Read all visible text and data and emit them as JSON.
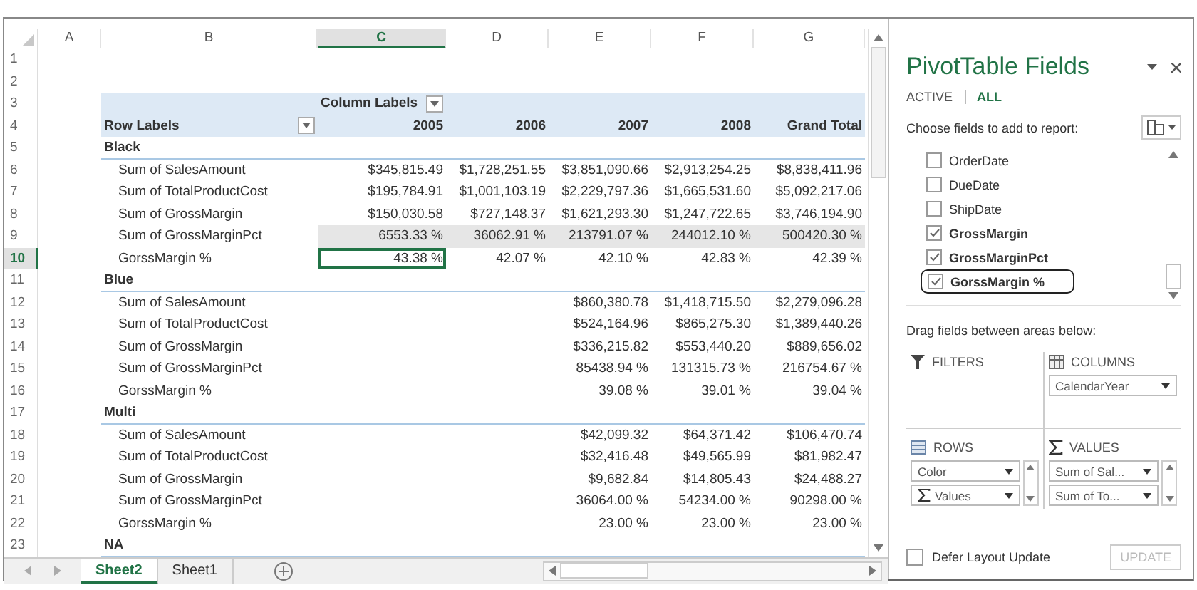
{
  "sheet": {
    "columns": [
      {
        "label": "A",
        "selected": false
      },
      {
        "label": "B",
        "selected": false
      },
      {
        "label": "C",
        "selected": true
      },
      {
        "label": "D",
        "selected": false
      },
      {
        "label": "E",
        "selected": false
      },
      {
        "label": "F",
        "selected": false
      },
      {
        "label": "G",
        "selected": false
      }
    ],
    "rows": [
      {
        "number": "1",
        "kind": "blank",
        "selected": false
      },
      {
        "number": "2",
        "kind": "blank",
        "selected": false
      },
      {
        "number": "3",
        "kind": "column-labels",
        "y2005": "Column Labels",
        "selected": false
      },
      {
        "number": "4",
        "kind": "header",
        "label": "Row Labels",
        "y2005": "2005",
        "y2006": "2006",
        "y2007": "2007",
        "y2008": "2008",
        "grand_total": "Grand Total",
        "selected": false
      },
      {
        "number": "5",
        "kind": "group",
        "label": "Black",
        "selected": false
      },
      {
        "number": "6",
        "kind": "measure",
        "label": "Sum of SalesAmount",
        "y2005": "$345,815.49",
        "y2006": "$1,728,251.55",
        "y2007": "$3,851,090.66",
        "y2008": "$2,913,254.25",
        "grand_total": "$8,838,411.96",
        "shaded": false,
        "selected": false
      },
      {
        "number": "7",
        "kind": "measure",
        "label": "Sum of TotalProductCost",
        "y2005": "$195,784.91",
        "y2006": "$1,001,103.19",
        "y2007": "$2,229,797.36",
        "y2008": "$1,665,531.60",
        "grand_total": "$5,092,217.06",
        "shaded": false,
        "selected": false
      },
      {
        "number": "8",
        "kind": "measure",
        "label": "Sum of GrossMargin",
        "y2005": "$150,030.58",
        "y2006": "$727,148.37",
        "y2007": "$1,621,293.30",
        "y2008": "$1,247,722.65",
        "grand_total": "$3,746,194.90",
        "shaded": false,
        "selected": false
      },
      {
        "number": "9",
        "kind": "measure",
        "label": "Sum of GrossMarginPct",
        "y2005": "6553.33 %",
        "y2006": "36062.91 %",
        "y2007": "213791.07 %",
        "y2008": "244012.10 %",
        "grand_total": "500420.30 %",
        "shaded": true,
        "selected": false
      },
      {
        "number": "10",
        "kind": "measure",
        "label": "GorssMargin %",
        "y2005": "43.38 %",
        "y2006": "42.07 %",
        "y2007": "42.10 %",
        "y2008": "42.83 %",
        "grand_total": "42.39 %",
        "shaded": false,
        "selected": true
      },
      {
        "number": "11",
        "kind": "group",
        "label": "Blue",
        "selected": false
      },
      {
        "number": "12",
        "kind": "measure",
        "label": "Sum of SalesAmount",
        "y2007": "$860,380.78",
        "y2008": "$1,418,715.50",
        "grand_total": "$2,279,096.28",
        "shaded": false,
        "selected": false
      },
      {
        "number": "13",
        "kind": "measure",
        "label": "Sum of TotalProductCost",
        "y2007": "$524,164.96",
        "y2008": "$865,275.30",
        "grand_total": "$1,389,440.26",
        "shaded": false,
        "selected": false
      },
      {
        "number": "14",
        "kind": "measure",
        "label": "Sum of GrossMargin",
        "y2007": "$336,215.82",
        "y2008": "$553,440.20",
        "grand_total": "$889,656.02",
        "shaded": false,
        "selected": false
      },
      {
        "number": "15",
        "kind": "measure",
        "label": "Sum of GrossMarginPct",
        "y2007": "85438.94 %",
        "y2008": "131315.73 %",
        "grand_total": "216754.67 %",
        "shaded": false,
        "selected": false
      },
      {
        "number": "16",
        "kind": "measure",
        "label": "GorssMargin %",
        "y2007": "39.08 %",
        "y2008": "39.01 %",
        "grand_total": "39.04 %",
        "shaded": false,
        "selected": false
      },
      {
        "number": "17",
        "kind": "group",
        "label": "Multi",
        "selected": false
      },
      {
        "number": "18",
        "kind": "measure",
        "label": "Sum of SalesAmount",
        "y2007": "$42,099.32",
        "y2008": "$64,371.42",
        "grand_total": "$106,470.74",
        "shaded": false,
        "selected": false
      },
      {
        "number": "19",
        "kind": "measure",
        "label": "Sum of TotalProductCost",
        "y2007": "$32,416.48",
        "y2008": "$49,565.99",
        "grand_total": "$81,982.47",
        "shaded": false,
        "selected": false
      },
      {
        "number": "20",
        "kind": "measure",
        "label": "Sum of GrossMargin",
        "y2007": "$9,682.84",
        "y2008": "$14,805.43",
        "grand_total": "$24,488.27",
        "shaded": false,
        "selected": false
      },
      {
        "number": "21",
        "kind": "measure",
        "label": "Sum of GrossMarginPct",
        "y2007": "36064.00 %",
        "y2008": "54234.00 %",
        "grand_total": "90298.00 %",
        "shaded": false,
        "selected": false
      },
      {
        "number": "22",
        "kind": "measure",
        "label": "GorssMargin %",
        "y2007": "23.00 %",
        "y2008": "23.00 %",
        "grand_total": "23.00 %",
        "shaded": false,
        "selected": false
      },
      {
        "number": "23",
        "kind": "group",
        "label": "NA",
        "selected": false
      }
    ],
    "tabs": [
      {
        "label": "Sheet2",
        "selected": true
      },
      {
        "label": "Sheet1",
        "selected": false
      }
    ]
  },
  "pane": {
    "title": "PivotTable Fields",
    "tabs": [
      {
        "label": "ACTIVE",
        "selected": false
      },
      {
        "label": "ALL",
        "selected": true
      }
    ],
    "instruction": "Choose fields to add to report:",
    "fields": [
      {
        "label": "OrderDate",
        "checked": false,
        "highlighted": false
      },
      {
        "label": "DueDate",
        "checked": false,
        "highlighted": false
      },
      {
        "label": "ShipDate",
        "checked": false,
        "highlighted": false
      },
      {
        "label": "GrossMargin",
        "checked": true,
        "highlighted": false
      },
      {
        "label": "GrossMarginPct",
        "checked": true,
        "highlighted": false
      },
      {
        "label": "GorssMargin %",
        "checked": true,
        "highlighted": true
      }
    ],
    "areas_hint": "Drag fields between areas below:",
    "areas": [
      {
        "kind": "filters",
        "label": "FILTERS"
      },
      {
        "kind": "columns",
        "label": "COLUMNS",
        "items": [
          {
            "label": "CalendarYear",
            "kind": "plain"
          }
        ]
      },
      {
        "kind": "rows",
        "label": "ROWS",
        "items": [
          {
            "label": "Color",
            "kind": "plain"
          },
          {
            "label": "Values",
            "kind": "sigma"
          }
        ]
      },
      {
        "kind": "values",
        "label": "VALUES",
        "items": [
          {
            "label": "Sum of Sal...",
            "kind": "plain"
          },
          {
            "label": "Sum of To...",
            "kind": "plain"
          }
        ]
      }
    ],
    "defer": {
      "label": "Defer Layout Update",
      "checked": false
    },
    "update": {
      "label": "UPDATE",
      "disabled": true
    }
  }
}
